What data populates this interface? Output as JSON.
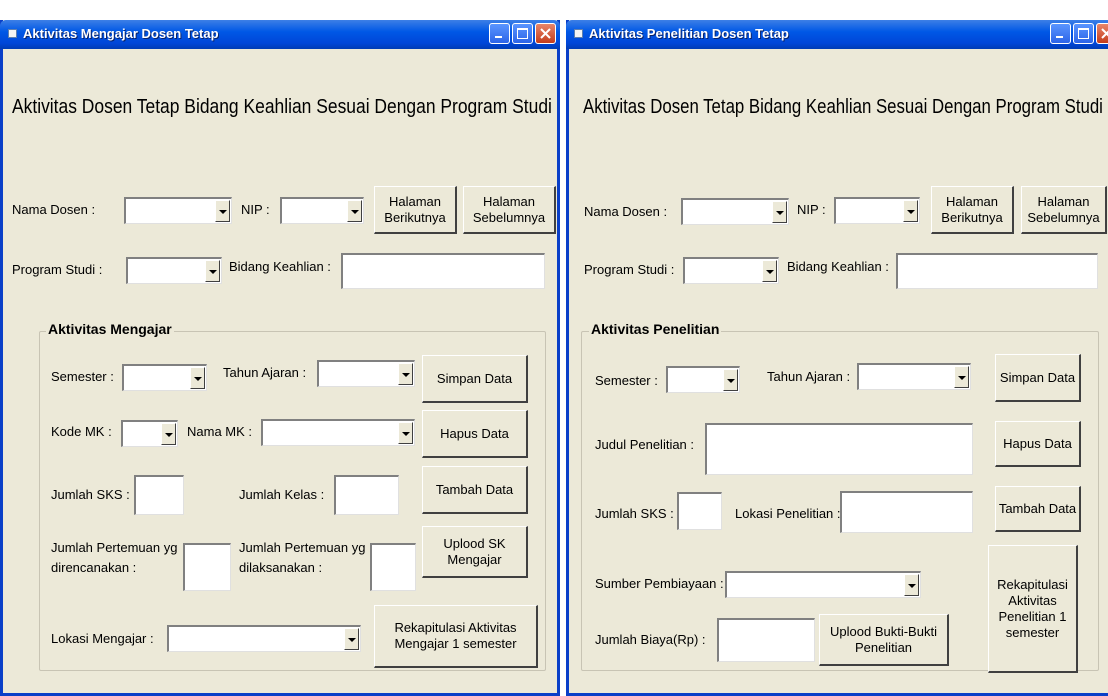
{
  "window1": {
    "title": "Aktivitas Mengajar Dosen Tetap",
    "heading": "Aktivitas Dosen Tetap Bidang Keahlian Sesuai Dengan Program Studi",
    "nama_dosen_label": "Nama Dosen :",
    "nip_label": "NIP :",
    "next_btn": [
      "Halaman",
      "Berikutnya"
    ],
    "prev_btn": [
      "Halaman",
      "Sebelumnya"
    ],
    "program_studi_label": "Program Studi :",
    "bidang_keahlian_label": "Bidang Keahlian :",
    "frame_title": "Aktivitas Mengajar",
    "semester_label": "Semester :",
    "tahun_ajaran_label": "Tahun Ajaran :",
    "simpan_btn": "Simpan Data",
    "kode_mk_label": "Kode MK :",
    "nama_mk_label": "Nama MK :",
    "hapus_btn": "Hapus Data",
    "jumlah_sks_label": "Jumlah SKS :",
    "jumlah_kelas_label": "Jumlah Kelas :",
    "tambah_btn": "Tambah Data",
    "pertemuan_rencana_label": [
      "Jumlah Pertemuan yg",
      "direncanakan :"
    ],
    "pertemuan_laksana_label": [
      "Jumlah Pertemuan yg",
      "dilaksanakan :"
    ],
    "upload_btn": [
      "Uplood SK",
      "Mengajar"
    ],
    "lokasi_label": "Lokasi Mengajar :",
    "rekap_btn": [
      "Rekapitulasi Aktivitas",
      "Mengajar 1 semester"
    ]
  },
  "window2": {
    "title": "Aktivitas Penelitian Dosen Tetap",
    "heading": "Aktivitas Dosen Tetap Bidang Keahlian Sesuai Dengan Program Studi",
    "nama_dosen_label": "Nama Dosen :",
    "nip_label": "NIP :",
    "next_btn": [
      "Halaman",
      "Berikutnya"
    ],
    "prev_btn": [
      "Halaman",
      "Sebelumnya"
    ],
    "program_studi_label": "Program Studi :",
    "bidang_keahlian_label": "Bidang Keahlian :",
    "frame_title": "Aktivitas Penelitian",
    "semester_label": "Semester :",
    "tahun_ajaran_label": "Tahun Ajaran :",
    "simpan_btn": "Simpan Data",
    "judul_label": "Judul Penelitian :",
    "hapus_btn": "Hapus Data",
    "jumlah_sks_label": "Jumlah SKS :",
    "lokasi_label": "Lokasi Penelitian :",
    "tambah_btn": "Tambah Data",
    "sumber_label": "Sumber Pembiayaan :",
    "rekap_btn": [
      "Rekapitulasi",
      "Aktivitas",
      "Penelitian 1",
      "semester"
    ],
    "biaya_label": "Jumlah Biaya(Rp) :",
    "upload_btn": [
      "Uplood Bukti-Bukti",
      "Penelitian"
    ]
  },
  "icons": {
    "app_icon": "app-icon",
    "minimize": "minimize-icon",
    "maximize": "maximize-icon",
    "close": "close-icon"
  },
  "colors": {
    "titlebar": "#0058e6",
    "window_bg": "#ece9d8",
    "close_button": "#c43c1c"
  }
}
